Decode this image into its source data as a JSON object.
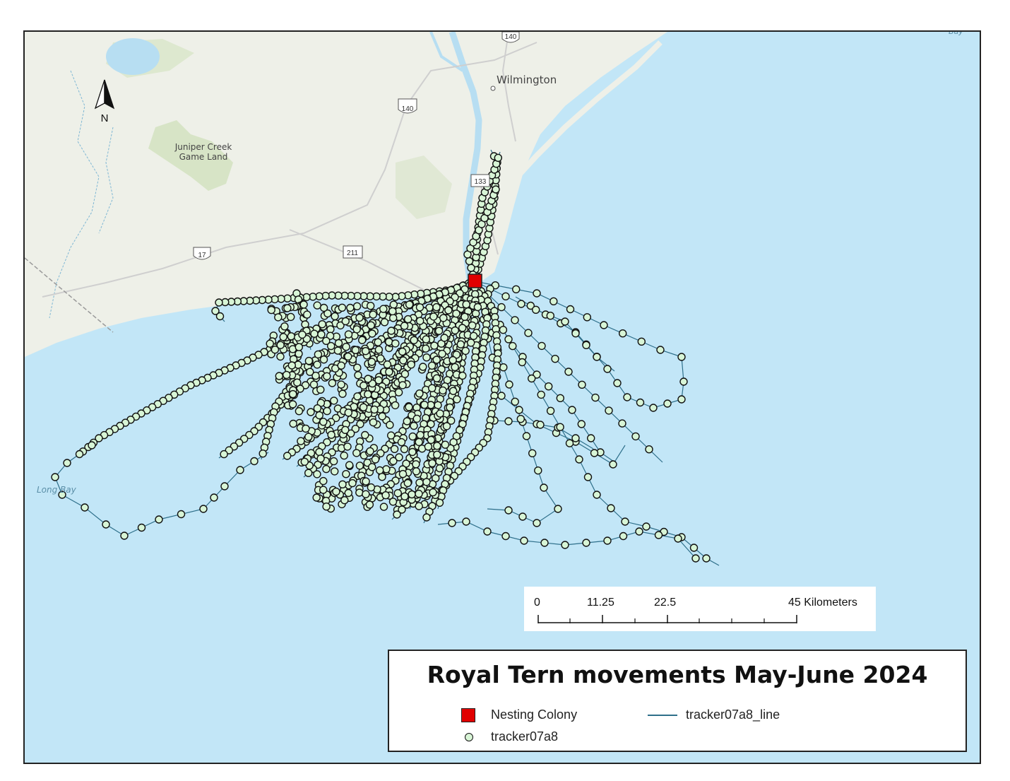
{
  "map": {
    "title": "Royal Tern movements May-June 2024",
    "north_arrow_label": "N",
    "places": {
      "wilmington": "Wilmington",
      "juniper_1": "Juniper Creek",
      "juniper_2": "Game Land",
      "long_bay": "Long Bay",
      "bay_corner": "Bay"
    },
    "road_shields": {
      "i140_top": "140",
      "i140": "140",
      "r133": "133",
      "us17": "17",
      "r211": "211"
    },
    "colors": {
      "ocean": "#c2e6f7",
      "land": "#eef0e8",
      "point_fill": "#d8f5d6",
      "point_stroke": "#111111",
      "track_line": "#2e6f8a",
      "colony": "#e00000"
    }
  },
  "scale_bar": {
    "labels": [
      "0",
      "11.25",
      "22.5",
      "45 Kilometers"
    ]
  },
  "legend": {
    "colony_label": "Nesting Colony",
    "points_label": "tracker07a8",
    "line_label": "tracker07a8_line"
  }
}
